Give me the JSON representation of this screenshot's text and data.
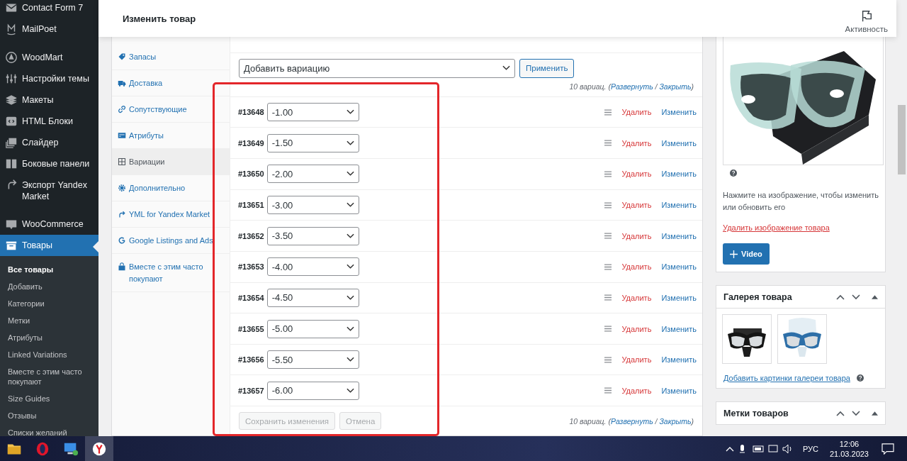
{
  "sidebar": {
    "menu": [
      {
        "label": "Contact Form 7",
        "selected": false
      },
      {
        "label": "MailPoet",
        "selected": false
      },
      {
        "label": "WoodMart",
        "selected": false
      },
      {
        "label": "Настройки темы",
        "selected": false
      },
      {
        "label": "Макеты",
        "selected": false
      },
      {
        "label": "HTML Блоки",
        "selected": false
      },
      {
        "label": "Слайдер",
        "selected": false
      },
      {
        "label": "Боковые панели",
        "selected": false
      },
      {
        "label": "Экспорт Yandex Market",
        "selected": false
      },
      {
        "label": "WooCommerce",
        "selected": false
      },
      {
        "label": "Товары",
        "selected": true
      }
    ],
    "submenu": [
      {
        "label": "Все товары",
        "selected": true
      },
      {
        "label": "Добавить",
        "selected": false
      },
      {
        "label": "Категории",
        "selected": false
      },
      {
        "label": "Метки",
        "selected": false
      },
      {
        "label": "Атрибуты",
        "selected": false
      },
      {
        "label": "Linked Variations",
        "selected": false
      },
      {
        "label": "Вместе с этим часто покупают",
        "selected": false
      },
      {
        "label": "Size Guides",
        "selected": false
      },
      {
        "label": "Отзывы",
        "selected": false
      },
      {
        "label": "Списки желаний",
        "selected": false
      }
    ]
  },
  "header": {
    "title": "Изменить товар",
    "activity": "Активность"
  },
  "product_tabs": [
    {
      "label": "Запасы",
      "selected": false
    },
    {
      "label": "Доставка",
      "selected": false
    },
    {
      "label": "Сопутствующие",
      "selected": false
    },
    {
      "label": "Атрибуты",
      "selected": false
    },
    {
      "label": "Вариации",
      "selected": true
    },
    {
      "label": "Дополнительно",
      "selected": false
    },
    {
      "label": "YML for Yandex Market",
      "selected": false
    },
    {
      "label": "Google Listings and Ads",
      "selected": false
    },
    {
      "label": "Вместе с этим часто покупают",
      "selected": false
    }
  ],
  "variations": {
    "add_select": "Добавить вариацию",
    "apply": "Применить",
    "count_lines": [
      {
        "count": "10 вариац. (",
        "expand": "Развернуть",
        "separator": "/",
        "collapse": "Закрыть",
        "close": ")"
      },
      {
        "count": "10 вариац. (",
        "expand": "Развернуть",
        "separator": "/",
        "collapse": "Закрыть",
        "close": ")"
      }
    ],
    "rows": [
      {
        "id": "#13648",
        "value": "-1.00",
        "delete": "Удалить",
        "edit": "Изменить"
      },
      {
        "id": "#13649",
        "value": "-1.50",
        "delete": "Удалить",
        "edit": "Изменить"
      },
      {
        "id": "#13650",
        "value": "-2.00",
        "delete": "Удалить",
        "edit": "Изменить"
      },
      {
        "id": "#13651",
        "value": "-3.00",
        "delete": "Удалить",
        "edit": "Изменить"
      },
      {
        "id": "#13652",
        "value": "-3.50",
        "delete": "Удалить",
        "edit": "Изменить"
      },
      {
        "id": "#13653",
        "value": "-4.00",
        "delete": "Удалить",
        "edit": "Изменить"
      },
      {
        "id": "#13654",
        "value": "-4.50",
        "delete": "Удалить",
        "edit": "Изменить"
      },
      {
        "id": "#13655",
        "value": "-5.00",
        "delete": "Удалить",
        "edit": "Изменить"
      },
      {
        "id": "#13656",
        "value": "-5.50",
        "delete": "Удалить",
        "edit": "Изменить"
      },
      {
        "id": "#13657",
        "value": "-6.00",
        "delete": "Удалить",
        "edit": "Изменить"
      }
    ],
    "save": "Сохранить изменения",
    "cancel": "Отмена",
    "save_disabled": true,
    "cancel_disabled": true
  },
  "product_image": {
    "hint": "Нажмите на изображение, чтобы изменить или обновить его",
    "remove": "Удалить изображение товара",
    "video": "Video"
  },
  "gallery": {
    "title": "Галерея товара",
    "add": "Добавить картинки галереи товара"
  },
  "tags_box": {
    "title": "Метки товаров"
  },
  "taskbar": {
    "apps": [
      {
        "selected": false
      },
      {
        "selected": false
      },
      {
        "selected": false
      },
      {
        "selected": true
      }
    ],
    "language": "РУС",
    "time": "12:06",
    "date": "21.03.2023"
  }
}
